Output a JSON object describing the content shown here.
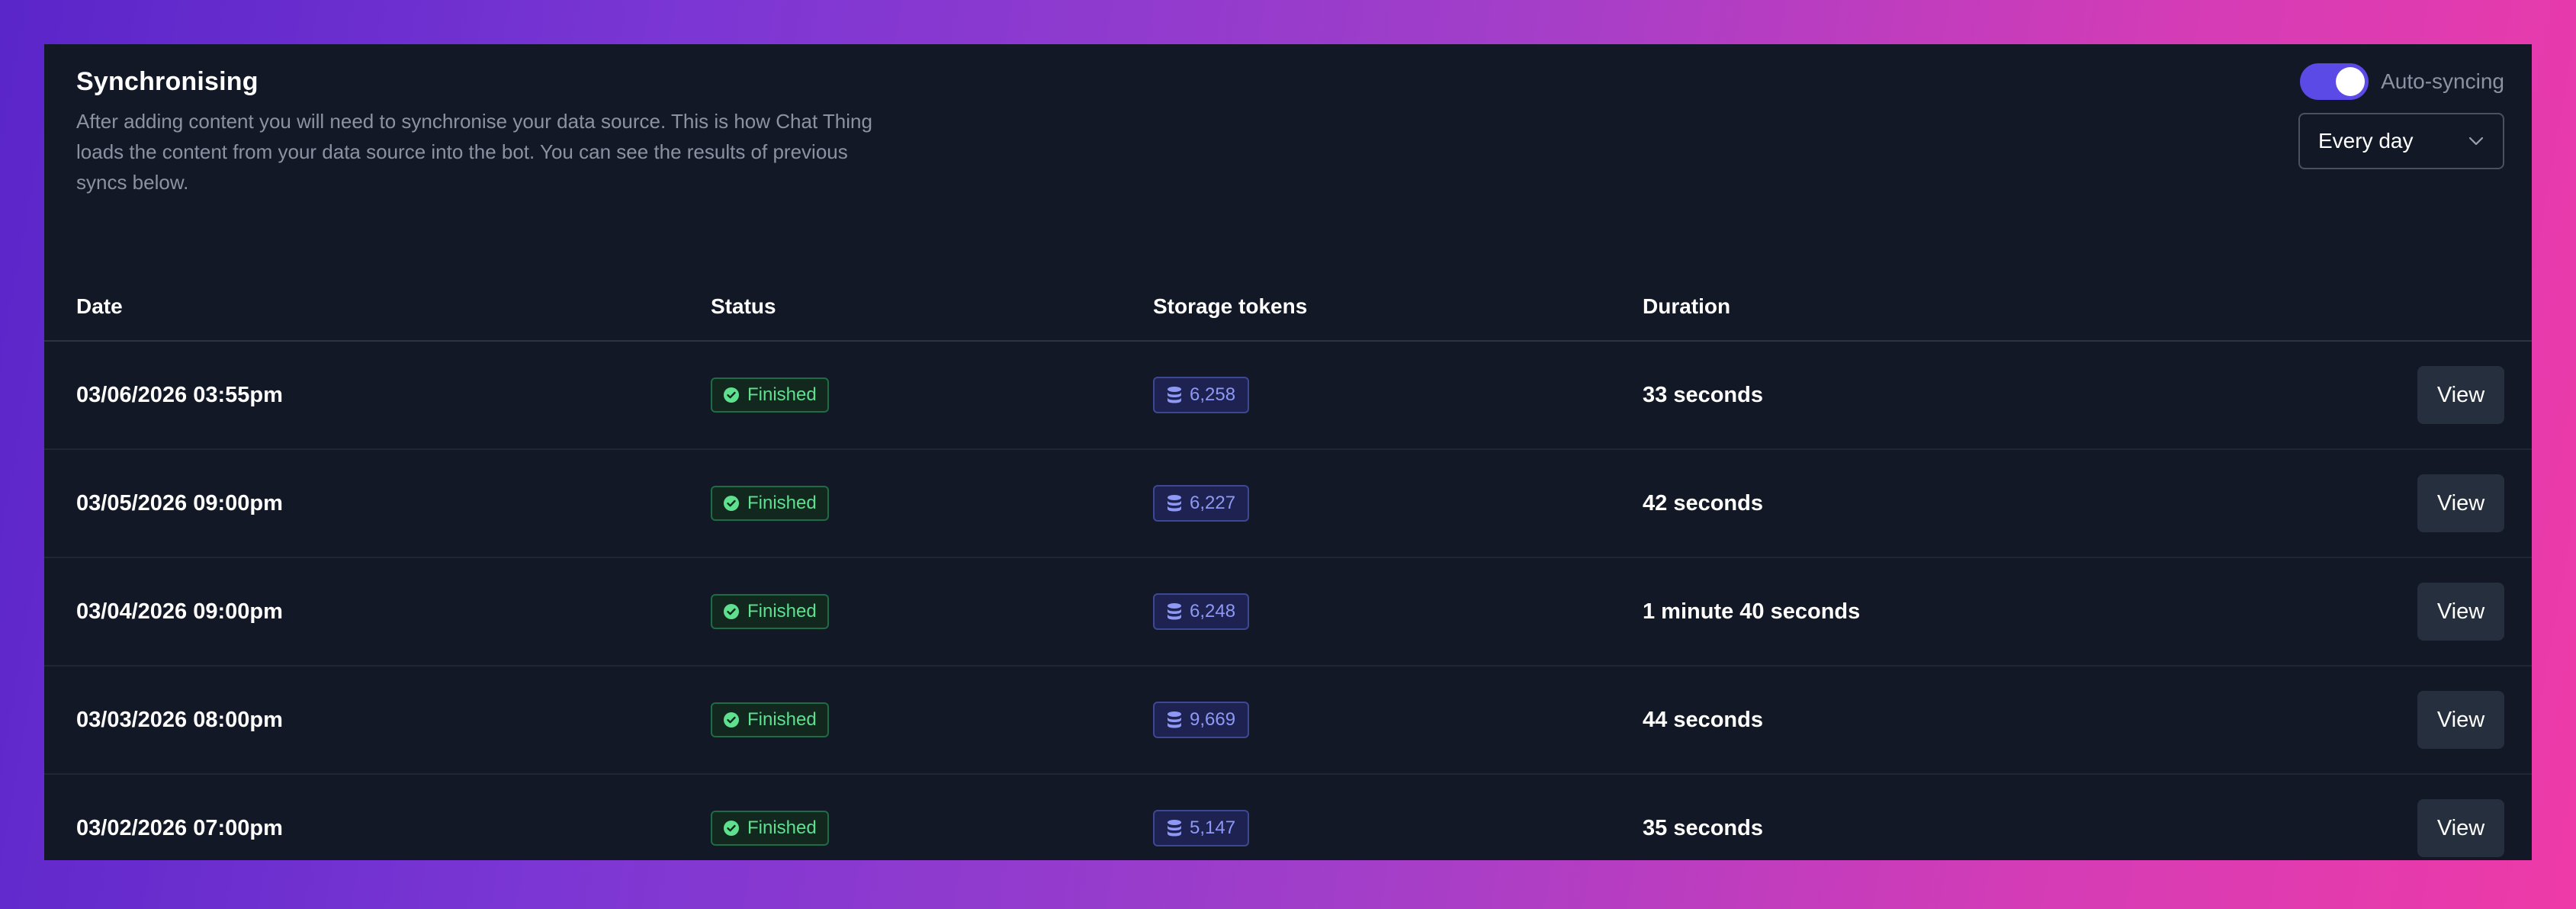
{
  "header": {
    "title": "Synchronising",
    "description": "After adding content you will need to synchronise your data source. This is how Chat Thing loads the content from your data source into the bot. You can see the results of previous syncs below."
  },
  "controls": {
    "toggle_label": "Auto-syncing",
    "toggle_on": true,
    "frequency_value": "Every day",
    "accent_color": "#5b4ae6"
  },
  "table": {
    "columns": [
      "Date",
      "Status",
      "Storage tokens",
      "Duration"
    ],
    "rows": [
      {
        "date": "03/06/2026 03:55pm",
        "status": "Finished",
        "tokens": "6,258",
        "duration": "33 seconds",
        "action": "View"
      },
      {
        "date": "03/05/2026 09:00pm",
        "status": "Finished",
        "tokens": "6,227",
        "duration": "42 seconds",
        "action": "View"
      },
      {
        "date": "03/04/2026 09:00pm",
        "status": "Finished",
        "tokens": "6,248",
        "duration": "1 minute 40 seconds",
        "action": "View"
      },
      {
        "date": "03/03/2026 08:00pm",
        "status": "Finished",
        "tokens": "9,669",
        "duration": "44 seconds",
        "action": "View"
      },
      {
        "date": "03/02/2026 07:00pm",
        "status": "Finished",
        "tokens": "5,147",
        "duration": "35 seconds",
        "action": "View"
      }
    ]
  },
  "icons": {
    "status": "check-circle-icon",
    "tokens": "database-icon",
    "select": "chevron-down-icon"
  }
}
